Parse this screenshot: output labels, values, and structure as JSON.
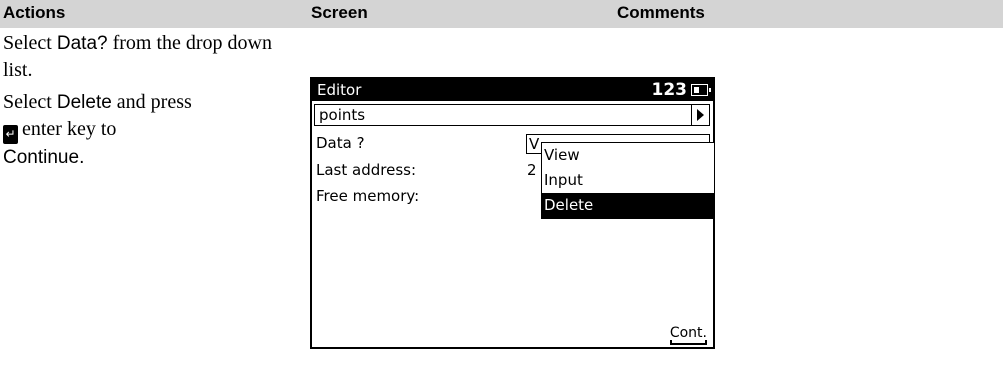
{
  "header": {
    "actions": "Actions",
    "screen": "Screen",
    "comments": "Comments"
  },
  "actions": {
    "step1_prefix": "Select ",
    "step1_term": "Data?",
    "step1_suffix": " from the drop down list.",
    "step2_prefix": "Select ",
    "step2_term": "Delete",
    "step2_mid": " and press",
    "enter_symbol": "↵",
    "step2_suffix": "enter key to",
    "step2_continue": "Continue",
    "step2_end": "."
  },
  "device": {
    "title": "Editor",
    "status": "123",
    "battery_icon": "battery-icon",
    "select_value": "points",
    "rows": {
      "data_label": "Data ?",
      "last_address_label": "Last address:",
      "free_memory_label": "Free memory:"
    },
    "data_field_value": "V",
    "last_address_value": "2",
    "dropdown_options": [
      "View",
      "Input",
      "Delete"
    ],
    "selected_option": "Delete",
    "softkey": "Cont."
  }
}
